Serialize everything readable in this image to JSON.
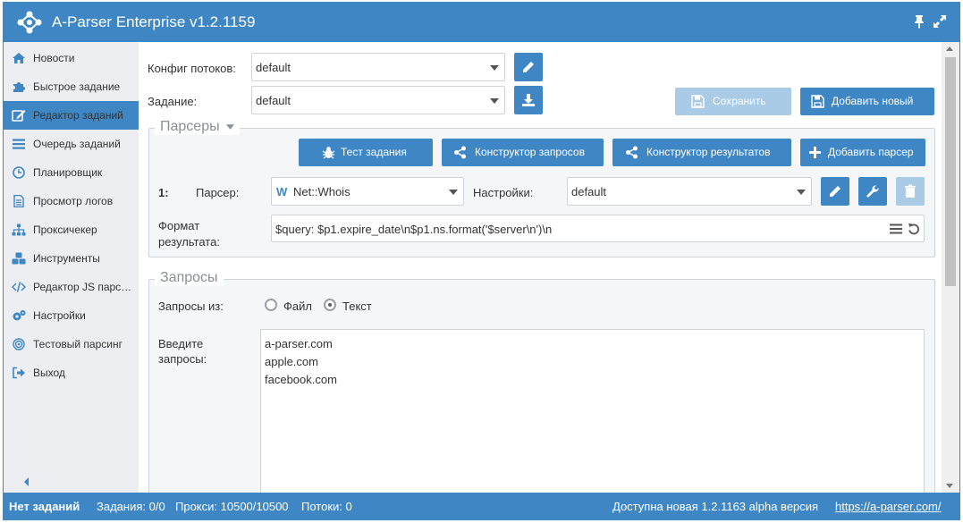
{
  "app": {
    "title": "A-Parser Enterprise v1.2.1159"
  },
  "sidebar": {
    "items": [
      {
        "label": "Новости",
        "icon": "home-icon"
      },
      {
        "label": "Быстрое задание",
        "icon": "puzzle-icon"
      },
      {
        "label": "Редактор заданий",
        "icon": "edit-icon",
        "active": true
      },
      {
        "label": "Очередь заданий",
        "icon": "list-icon"
      },
      {
        "label": "Планировщик",
        "icon": "clock-icon"
      },
      {
        "label": "Просмотр логов",
        "icon": "file-icon"
      },
      {
        "label": "Проксичекер",
        "icon": "sitemap-icon"
      },
      {
        "label": "Инструменты",
        "icon": "cubes-icon"
      },
      {
        "label": "Редактор JS парс…",
        "icon": "code-icon"
      },
      {
        "label": "Настройки",
        "icon": "gears-icon"
      },
      {
        "label": "Тестовый парсинг",
        "icon": "target-icon"
      },
      {
        "label": "Выход",
        "icon": "sign-out-icon"
      }
    ]
  },
  "form": {
    "threads_config_label": "Конфиг потоков:",
    "threads_config_value": "default",
    "task_label": "Задание:",
    "task_value": "default",
    "save_label": "Сохранить",
    "add_new_label": "Добавить новый"
  },
  "parsers": {
    "legend": "Парсеры",
    "test_task_label": "Тест задания",
    "query_builder_label": "Конструктор запросов",
    "result_builder_label": "Конструктор результатов",
    "add_parser_label": "Добавить парсер",
    "row_index": "1:",
    "parser_label": "Парсер:",
    "parser_value": "Net::Whois",
    "parser_badge": "W",
    "settings_label": "Настройки:",
    "settings_value": "default",
    "format_label_1": "Формат",
    "format_label_2": "результата:",
    "format_value": "$query: $p1.expire_date\\n$p1.ns.format('$server\\n')\\n"
  },
  "queries": {
    "legend": "Запросы",
    "source_label": "Запросы из:",
    "option_file": "Файл",
    "option_text": "Текст",
    "selected_option": "Текст",
    "input_label_1": "Введите",
    "input_label_2": "запросы:",
    "lines": [
      "a-parser.com",
      "apple.com",
      "facebook.com"
    ]
  },
  "status": {
    "no_tasks": "Нет заданий",
    "tasks": "Задания: 0/0",
    "proxies": "Прокси: 10500/10500",
    "threads": "Потоки: 0",
    "update_notice": "Доступна новая 1.2.1163 alpha версия",
    "link": "https://a-parser.com/"
  },
  "colors": {
    "accent": "#3f87c4",
    "sidebar_bg": "#eceef2",
    "disabled": "#a9cbe6"
  }
}
